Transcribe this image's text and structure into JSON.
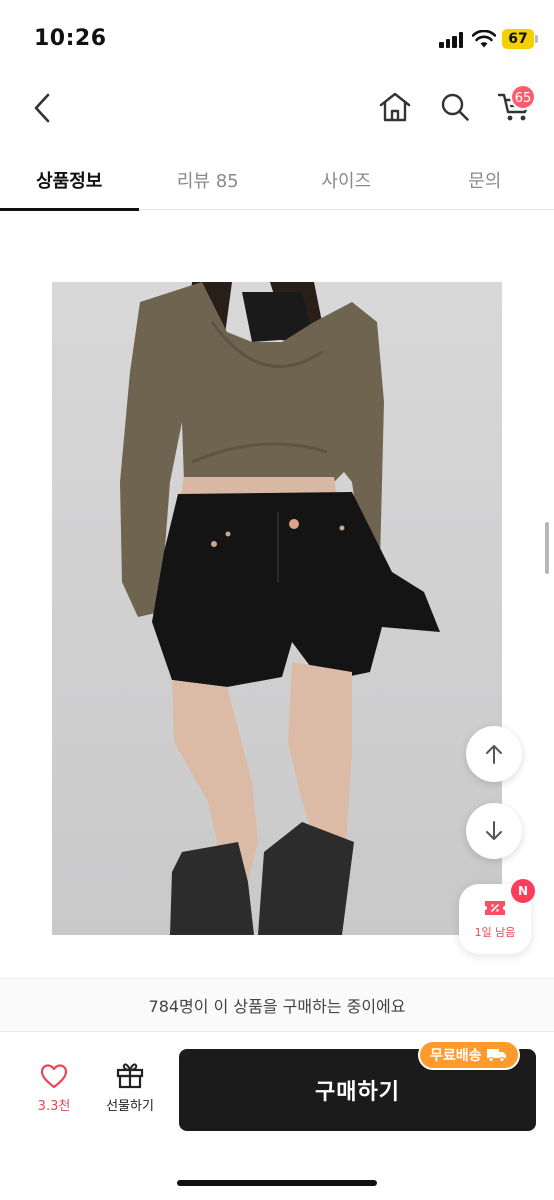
{
  "status_bar": {
    "time": "10:26",
    "battery": "67",
    "icons": [
      "signal-icon",
      "wifi-icon",
      "battery-icon"
    ]
  },
  "header": {
    "icons": [
      "back-arrow-icon",
      "home-icon",
      "search-icon",
      "cart-icon"
    ],
    "cart_count": "65"
  },
  "tabs": [
    {
      "label": "상품정보",
      "active": true
    },
    {
      "label": "리뷰 85",
      "active": false
    },
    {
      "label": "사이즈",
      "active": false
    },
    {
      "label": "문의",
      "active": false
    }
  ],
  "floating": {
    "up_icon": "arrow-up-icon",
    "down_icon": "arrow-down-icon",
    "coupon_label": "1일 남음",
    "coupon_badge": "N",
    "coupon_icon": "coupon-ticket-icon"
  },
  "notice": {
    "text": "784명이 이 상품을 구매하는 중이에요"
  },
  "bottom_bar": {
    "like_count": "3.3천",
    "gift_label": "선물하기",
    "buy_label": "구매하기",
    "free_shipping_label": "무료배송"
  },
  "colors": {
    "accent_red": "#e8485a",
    "badge_red": "#ff5a6e",
    "buy_button": "#1b1b1b",
    "shipping_orange": "#ff9a2e",
    "battery_yellow": "#f5d000"
  }
}
